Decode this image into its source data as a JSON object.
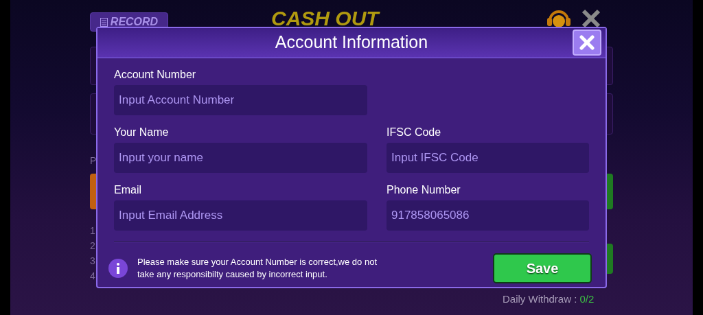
{
  "background": {
    "record_button": "RECORD",
    "title": "CASH OUT",
    "label_fragment": "P",
    "list_numbers": [
      "1",
      "2",
      "3",
      "4"
    ],
    "daily_withdraw": {
      "label": "Daily Withdraw : ",
      "count": "0/2"
    }
  },
  "dialog": {
    "title": "Account Information",
    "fields": [
      {
        "label": "Account Number",
        "placeholder": "Input Account Number"
      },
      {
        "label": "Your Name",
        "placeholder": "Input your name"
      },
      {
        "label": "IFSC Code",
        "placeholder": "Input IFSC Code"
      },
      {
        "label": "Email",
        "placeholder": "Input Email Address"
      },
      {
        "label": "Phone Number",
        "value": "917858065086"
      }
    ],
    "notice": "Please make sure your Account Number is correct,we do not take any responsibilty caused by incorrect input.",
    "save_button": "Save"
  }
}
